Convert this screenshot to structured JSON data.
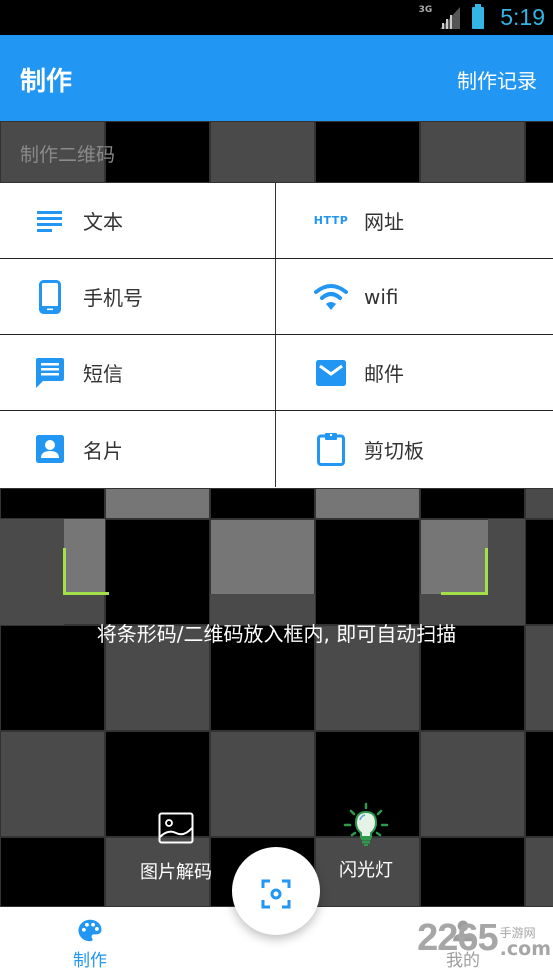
{
  "status_bar": {
    "network": "3G",
    "time": "5:19",
    "accent_color": "#33b5e5"
  },
  "app_bar": {
    "title": "制作",
    "action": "制作记录",
    "color": "#2196f3"
  },
  "create_section": {
    "label": "制作二维码",
    "items": [
      {
        "label": "文本",
        "icon": "text-lines-icon"
      },
      {
        "label": "网址",
        "icon": "http-icon",
        "icon_text": "HTTP"
      },
      {
        "label": "手机号",
        "icon": "phone-icon"
      },
      {
        "label": "wifi",
        "icon": "wifi-icon"
      },
      {
        "label": "短信",
        "icon": "sms-icon"
      },
      {
        "label": "邮件",
        "icon": "mail-icon"
      },
      {
        "label": "名片",
        "icon": "contact-card-icon"
      },
      {
        "label": "剪切板",
        "icon": "clipboard-icon"
      }
    ]
  },
  "scanner": {
    "hint": "将条形码/二维码放入框内, 即可自动扫描",
    "frame_color": "#a4e04a",
    "tools": [
      {
        "label": "图片解码",
        "icon": "image-icon"
      },
      {
        "label": "闪光灯",
        "icon": "flashlight-bulb-icon"
      }
    ]
  },
  "bottom_nav": {
    "items": [
      {
        "label": "制作",
        "icon": "palette-icon",
        "active": true
      },
      {
        "label": "我的",
        "icon": "person-icon",
        "active": false
      }
    ],
    "fab_icon": "scan-icon",
    "active_color": "#2196f3"
  },
  "watermark": {
    "number": "2265",
    "site_cn": "手游网",
    "site_domain": ".com"
  }
}
